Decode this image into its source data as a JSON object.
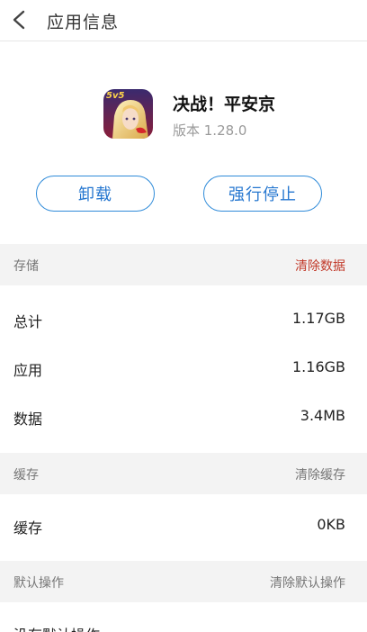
{
  "header": {
    "title": "应用信息",
    "back_icon": "chevron-left-icon"
  },
  "app": {
    "name": "决战！平安京",
    "version": "版本 1.28.0",
    "icon_badge": "5v5"
  },
  "buttons": {
    "uninstall": "卸载",
    "force_stop": "强行停止"
  },
  "storage": {
    "header": "存储",
    "action": "清除数据",
    "action_color": "#c23a2a",
    "rows": [
      {
        "label": "总计",
        "value": "1.17GB"
      },
      {
        "label": "应用",
        "value": "1.16GB"
      },
      {
        "label": "数据",
        "value": "3.4MB"
      }
    ]
  },
  "cache": {
    "header": "缓存",
    "action": "清除缓存",
    "rows": [
      {
        "label": "缓存",
        "value": "0KB"
      }
    ]
  },
  "defaults": {
    "header": "默认操作",
    "action": "清除默认操作",
    "rows": [
      {
        "label": "没有默认操作"
      }
    ]
  },
  "colors": {
    "accent": "#2f8bd9",
    "danger": "#c23a2a",
    "section_bg": "#f3f3f3"
  }
}
